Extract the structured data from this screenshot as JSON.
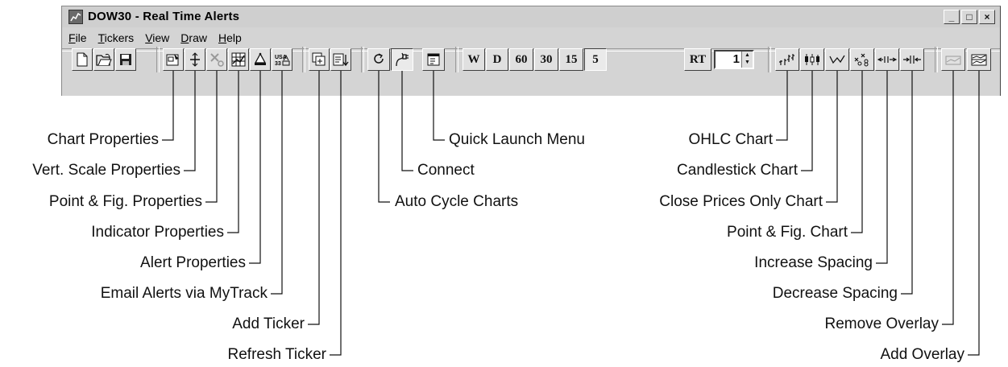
{
  "window": {
    "title": "DOW30 - Real Time Alerts",
    "controls": [
      "_",
      "□",
      "×"
    ]
  },
  "menu": [
    {
      "accel": "F",
      "rest": "ile"
    },
    {
      "accel": "T",
      "rest": "ickers"
    },
    {
      "accel": "V",
      "rest": "iew"
    },
    {
      "accel": "D",
      "rest": "raw"
    },
    {
      "accel": "H",
      "rest": "elp"
    }
  ],
  "toolbar": {
    "interval_buttons": [
      "W",
      "D",
      "60",
      "30",
      "15",
      "5"
    ],
    "rt_label": "RT",
    "spin_value": "1",
    "icons": [
      "new-icon",
      "open-icon",
      "save-icon",
      "chart-properties-icon",
      "vert-scale-icon",
      "point-fig-properties-icon",
      "indicator-properties-icon",
      "alert-properties-icon",
      "email-alerts-icon",
      "add-ticker-icon",
      "refresh-ticker-icon",
      "auto-cycle-icon",
      "connect-icon",
      "quick-launch-icon",
      "ohlc-chart-icon",
      "candlestick-chart-icon",
      "close-prices-chart-icon",
      "point-fig-chart-icon",
      "increase-spacing-icon",
      "decrease-spacing-icon",
      "remove-overlay-icon",
      "add-overlay-icon"
    ]
  },
  "callouts": {
    "chart_properties": "Chart Properties",
    "vert_scale": "Vert. Scale Properties",
    "point_fig_properties": "Point & Fig. Properties",
    "indicator_properties": "Indicator Properties",
    "alert_properties": "Alert Properties",
    "email_alerts": "Email Alerts via MyTrack",
    "add_ticker": "Add Ticker",
    "refresh_ticker": "Refresh Ticker",
    "quick_launch": "Quick Launch Menu",
    "connect": "Connect",
    "auto_cycle": "Auto Cycle Charts",
    "ohlc_chart": "OHLC Chart",
    "candlestick_chart": "Candlestick Chart",
    "close_prices_chart": "Close Prices Only Chart",
    "point_fig_chart": "Point & Fig. Chart",
    "increase_spacing": "Increase Spacing",
    "decrease_spacing": "Decrease Spacing",
    "remove_overlay": "Remove Overlay",
    "add_overlay": "Add Overlay"
  }
}
